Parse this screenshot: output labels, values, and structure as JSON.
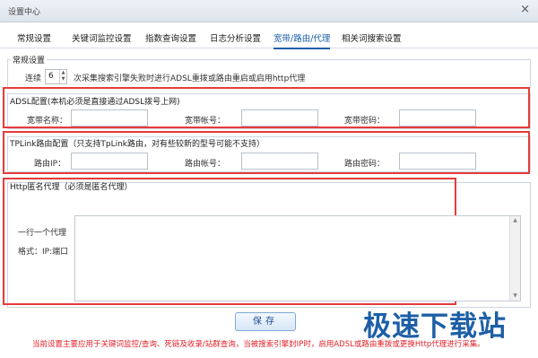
{
  "window": {
    "title": "设置中心",
    "close_glyph": "×"
  },
  "tabs": [
    {
      "label": "常规设置"
    },
    {
      "label": "关键词监控设置"
    },
    {
      "label": "指数查询设置"
    },
    {
      "label": "日志分析设置"
    },
    {
      "label": "宽带/路由/代理",
      "active": true
    },
    {
      "label": "相关词搜索设置"
    }
  ],
  "general": {
    "group_label": "常规设置",
    "retry_label": "连续",
    "retry_value": "6",
    "retry_desc": "次采集搜索引擎失败时进行ADSL重拨或路由重启或启用http代理"
  },
  "adsl": {
    "group_label": "ADSL配置(本机必须是直接通过ADSL拨号上网)",
    "name_label": "宽带名称：",
    "account_label": "宽带帐号：",
    "password_label": "宽带密码：",
    "name_value": "",
    "account_value": "",
    "password_value": ""
  },
  "tplink": {
    "group_label": "TPLink路由配置（只支持TpLink路由，对有些较新的型号可能不支持）",
    "ip_label": "路由IP：",
    "account_label": "路由帐号：",
    "password_label": "路由密码：",
    "ip_value": "",
    "account_value": "",
    "password_value": ""
  },
  "http_proxy": {
    "group_label": "Http匿名代理（必须是匿名代理）",
    "hint_line1": "一行一个代理",
    "hint_line2": "格式：IP:端口",
    "value": ""
  },
  "save_label": "保存",
  "notice": "当前设置主要应用于关键词监控/查询、死链及收录/站群查询，当被搜索引擎封IP时，启用ADSL或路由重拨或更换Http代理进行采集。",
  "watermark": "极速下载站",
  "colors": {
    "highlight_box": "#e53b3b",
    "active_tab": "#1c5ea8",
    "notice": "#e0222a"
  }
}
